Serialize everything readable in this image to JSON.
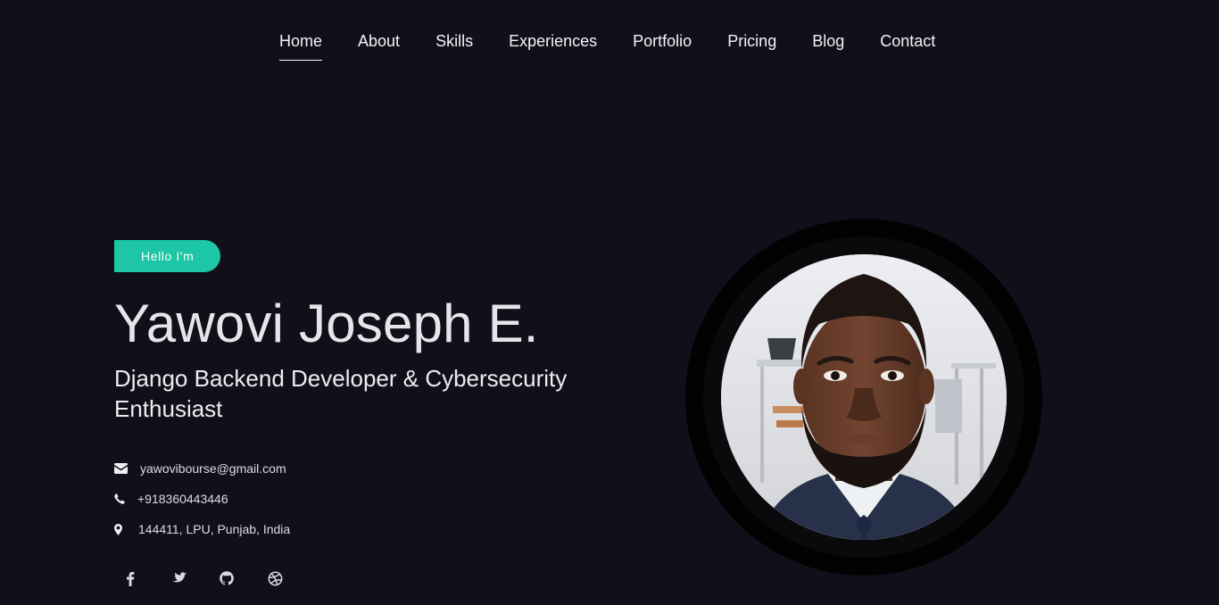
{
  "nav": {
    "items": [
      {
        "label": "Home",
        "active": true
      },
      {
        "label": "About"
      },
      {
        "label": "Skills"
      },
      {
        "label": "Experiences"
      },
      {
        "label": "Portfolio"
      },
      {
        "label": "Pricing"
      },
      {
        "label": "Blog"
      },
      {
        "label": "Contact"
      }
    ]
  },
  "hero": {
    "badge": "Hello I'm",
    "name": "Yawovi Joseph E.",
    "role": "Django Backend Developer & Cybersecurity Enthusiast",
    "contacts": {
      "email": "yawovibourse@gmail.com",
      "phone": "+918360443446",
      "address": "144411, LPU, Punjab, India"
    }
  },
  "social": [
    "facebook-icon",
    "twitter-icon",
    "github-icon",
    "dribbble-icon"
  ],
  "colors": {
    "background": "#11101a",
    "accent": "#1cc6a6"
  }
}
